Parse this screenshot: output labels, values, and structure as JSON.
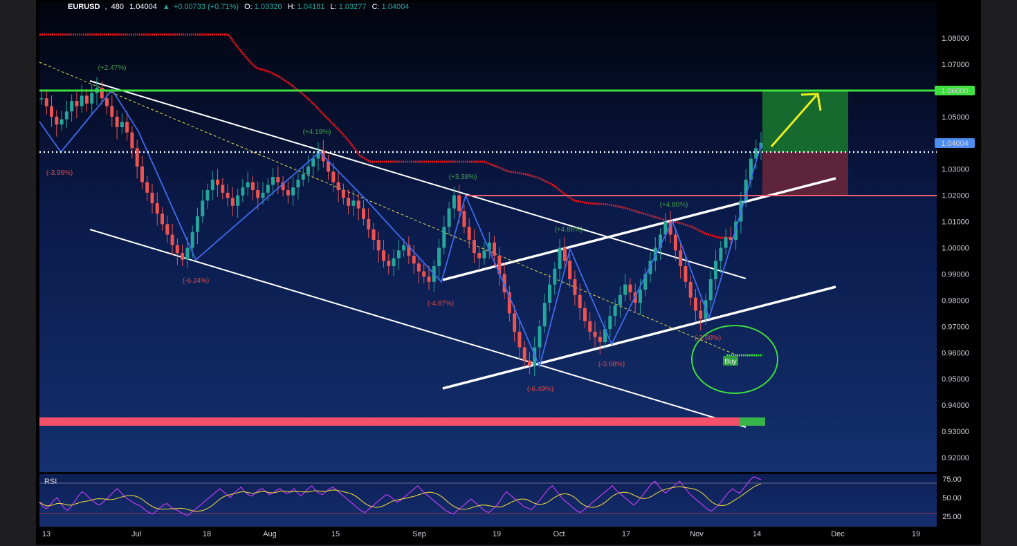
{
  "header": {
    "symbol": "EURUSD",
    "interval": "480",
    "last": "1.04004",
    "change": "+0.00733 (+0.71%)",
    "open_label": "O:",
    "open": "1.03320",
    "high_label": "H:",
    "high": "1.04181",
    "low_label": "L:",
    "low": "1.03277",
    "close_label": "C:",
    "close": "1.04004"
  },
  "rsi": {
    "label": "RSI",
    "ticks": [
      "75.00",
      "50.00",
      "25.00"
    ],
    "upper": 70,
    "lower": 30,
    "values": [
      44,
      38,
      35,
      40,
      46,
      50,
      42,
      36,
      33,
      38,
      45,
      52,
      58,
      55,
      50,
      46,
      42,
      40,
      44,
      48,
      53,
      58,
      62,
      57,
      52,
      48,
      45,
      42,
      40,
      37,
      33,
      30,
      28,
      32,
      36,
      40,
      42,
      38,
      35,
      33,
      30,
      28,
      26,
      30,
      34,
      38,
      42,
      46,
      50,
      54,
      58,
      62,
      58,
      54,
      50,
      56,
      60,
      64,
      58,
      54,
      52,
      56,
      60,
      62,
      58,
      54,
      56,
      60,
      62,
      58,
      55,
      58,
      62,
      56,
      52,
      58,
      62,
      66,
      60,
      56,
      54,
      58,
      62,
      64,
      60,
      56,
      52,
      48,
      44,
      40,
      36,
      32,
      30,
      34,
      38,
      42,
      46,
      50,
      54,
      52,
      48,
      44,
      46,
      50,
      54,
      58,
      62,
      66,
      60,
      56,
      52,
      48,
      44,
      40,
      36,
      32,
      30,
      28,
      32,
      36,
      40,
      44,
      48,
      44,
      40,
      36,
      32,
      30,
      34,
      38,
      44,
      52,
      58,
      54,
      50,
      46,
      42,
      38,
      36,
      34,
      38,
      44,
      50,
      56,
      62,
      66,
      60,
      54,
      48,
      44,
      40,
      36,
      32,
      30,
      34,
      38,
      42,
      46,
      50,
      54,
      58,
      62,
      66,
      60,
      56,
      52,
      48,
      44,
      40,
      44,
      50,
      56,
      62,
      68,
      72,
      66,
      60,
      56,
      60,
      64,
      68,
      72,
      66,
      60,
      54,
      50,
      46,
      42,
      38,
      34,
      32,
      36,
      40,
      46,
      52,
      58,
      62,
      58,
      56,
      62,
      68,
      74,
      78,
      76,
      74
    ]
  },
  "chart_data": {
    "type": "candlestick",
    "symbol": "EURUSD",
    "yaxis_ticks": [
      "1.08000",
      "1.07000",
      "1.06000",
      "1.05000",
      "1.04004",
      "1.03000",
      "1.02000",
      "1.01000",
      "1.00000",
      "0.99000",
      "0.98000",
      "0.97000",
      "0.96000",
      "0.95000",
      "0.94000",
      "0.93000",
      "0.92000"
    ],
    "ylim": [
      0.915,
      1.088
    ],
    "xaxis_ticks": [
      "13",
      "Jul",
      "18",
      "Aug",
      "15",
      "Sep",
      "19",
      "Oct",
      "17",
      "Nov",
      "14",
      "Dec",
      "19"
    ],
    "price_tags": {
      "target": "1.06000",
      "current": "1.04004"
    },
    "target_level": 1.06,
    "resistance_level": 1.02,
    "current_price": 1.04004,
    "zigzag_labels": [
      {
        "text": "(+2.47%)",
        "color": "#3fa142"
      },
      {
        "text": "(-3.96%)",
        "color": "#e04b4b"
      },
      {
        "text": "(-6.24%)",
        "color": "#e04b4b"
      },
      {
        "text": "(+4.19%)",
        "color": "#3fa142"
      },
      {
        "text": "(+3.38%)",
        "color": "#3fa142"
      },
      {
        "text": "(-4.87%)",
        "color": "#e04b4b"
      },
      {
        "text": "(-6.49%)",
        "color": "#e04b4b"
      },
      {
        "text": "(+4.86%)",
        "color": "#3fa142"
      },
      {
        "text": "(-3.68%)",
        "color": "#e04b4b"
      },
      {
        "text": "(+4.80%)",
        "color": "#3fa142"
      },
      {
        "text": "(-3.60%)",
        "color": "#e04b4b"
      }
    ],
    "zigzag_prices": [
      1.057,
      1.048,
      1.061,
      0.9955,
      1.037,
      0.987,
      1.02,
      0.955,
      1.0,
      0.964,
      1.01,
      0.973,
      1.04
    ],
    "buy_label": "Buy",
    "candle_closes": [
      1.057,
      1.054,
      1.05,
      1.047,
      1.049,
      1.052,
      1.056,
      1.054,
      1.058,
      1.055,
      1.059,
      1.061,
      1.057,
      1.054,
      1.05,
      1.046,
      1.048,
      1.044,
      1.038,
      1.031,
      1.025,
      1.021,
      1.017,
      1.013,
      1.009,
      1.005,
      1.001,
      0.998,
      0.9955,
      1.0,
      1.006,
      1.012,
      1.018,
      1.022,
      1.026,
      1.024,
      1.021,
      1.019,
      1.016,
      1.02,
      1.023,
      1.025,
      1.022,
      1.019,
      1.021,
      1.024,
      1.027,
      1.025,
      1.022,
      1.02,
      1.023,
      1.026,
      1.028,
      1.031,
      1.034,
      1.037,
      1.033,
      1.029,
      1.025,
      1.022,
      1.019,
      1.016,
      1.018,
      1.015,
      1.011,
      1.007,
      1.003,
      0.999,
      0.995,
      0.993,
      0.996,
      0.999,
      1.001,
      0.997,
      0.994,
      0.991,
      0.989,
      0.987,
      0.993,
      1.0,
      1.008,
      1.015,
      1.02,
      1.014,
      1.008,
      1.003,
      0.998,
      0.996,
      0.999,
      1.002,
      0.997,
      0.99,
      0.983,
      0.975,
      0.968,
      0.962,
      0.957,
      0.955,
      0.962,
      0.97,
      0.979,
      0.986,
      0.992,
      1.0,
      0.995,
      0.988,
      0.982,
      0.977,
      0.972,
      0.968,
      0.966,
      0.964,
      0.969,
      0.974,
      0.978,
      0.982,
      0.986,
      0.983,
      0.979,
      0.984,
      0.99,
      0.995,
      1.0,
      1.005,
      1.01,
      1.005,
      0.999,
      0.993,
      0.987,
      0.981,
      0.976,
      0.973,
      0.98,
      0.988,
      0.995,
      1.0,
      1.004,
      1.003,
      1.01,
      1.018,
      1.026,
      1.034,
      1.038,
      1.04
    ]
  }
}
